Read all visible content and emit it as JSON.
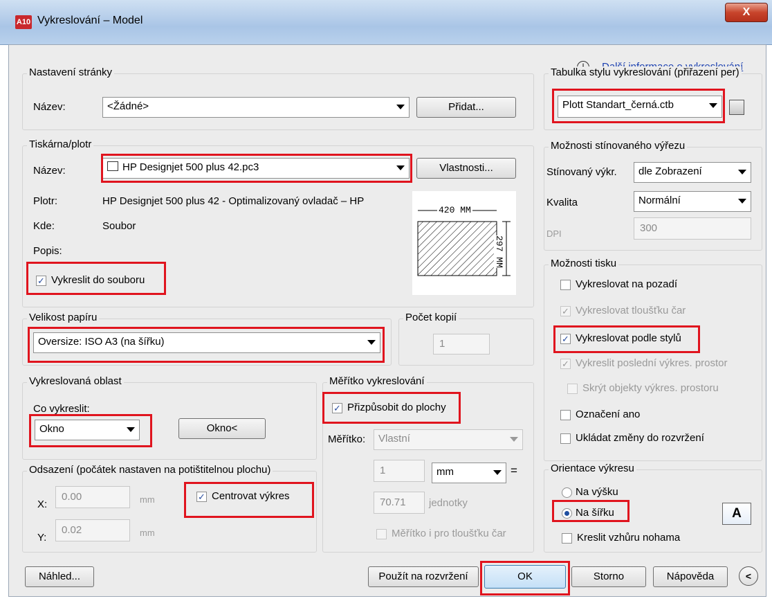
{
  "window": {
    "title": "Vykreslování – Model",
    "icon_text": "A10",
    "close_label": "X"
  },
  "more_info_link": "Další informace o vykreslování",
  "page_setup": {
    "group_label": "Nastavení stránky",
    "name_label": "Název:",
    "name_value": "<Žádné>",
    "add_button": "Přidat..."
  },
  "printer": {
    "group_label": "Tiskárna/plotr",
    "name_label": "Název:",
    "name_value": "HP Designjet 500 plus 42.pc3",
    "properties_button": "Vlastnosti...",
    "plotter_label": "Plotr:",
    "plotter_value": "HP Designjet 500 plus 42 - Optimalizovaný ovladač – HP",
    "where_label": "Kde:",
    "where_value": "Soubor",
    "desc_label": "Popis:",
    "plot_to_file_label": "Vykreslit do souboru",
    "plot_to_file_checked": true,
    "preview_width_label": "420 MM",
    "preview_height_label": "297 MM"
  },
  "paper_size": {
    "group_label": "Velikost papíru",
    "value": "Oversize: ISO A3 (na šířku)"
  },
  "copies": {
    "group_label": "Počet kopií",
    "value": "1"
  },
  "plot_area": {
    "group_label": "Vykreslovaná oblast",
    "what_label": "Co vykreslit:",
    "what_value": "Okno",
    "window_button": "Okno<"
  },
  "offset": {
    "group_label": "Odsazení (počátek nastaven na potištitelnou plochu)",
    "x_label": "X:",
    "x_value": "0.00",
    "y_label": "Y:",
    "y_value": "0.02",
    "unit": "mm",
    "center_label": "Centrovat výkres",
    "center_checked": true
  },
  "scale": {
    "group_label": "Měřítko vykreslování",
    "fit_label": "Přizpůsobit do plochy",
    "fit_checked": true,
    "scale_label": "Měřítko:",
    "scale_value": "Vlastní",
    "value1": "1",
    "unit_value": "mm",
    "equals": "=",
    "value2": "70.71",
    "units_label": "jednotky",
    "lineweights_label": "Měřítko i pro tloušťku čar"
  },
  "plot_style_table": {
    "group_label": "Tabulka stylu vykreslování (přiřazení per)",
    "value": "Plott Standart_černá.ctb"
  },
  "shaded_viewport": {
    "group_label": "Možnosti stínovaného výřezu",
    "shade_label": "Stínovaný výkr.",
    "shade_value": "dle Zobrazení",
    "quality_label": "Kvalita",
    "quality_value": "Normální",
    "dpi_label": "DPI",
    "dpi_value": "300"
  },
  "plot_options": {
    "group_label": "Možnosti tisku",
    "items": [
      {
        "label": "Vykreslovat na pozadí",
        "checked": false,
        "enabled": true
      },
      {
        "label": "Vykreslovat tloušťku čar",
        "checked": true,
        "enabled": false
      },
      {
        "label": "Vykreslovat podle stylů",
        "checked": true,
        "enabled": true
      },
      {
        "label": "Vykreslit poslední výkres. prostor",
        "checked": true,
        "enabled": false
      },
      {
        "label": "Skrýt objekty výkres. prostoru",
        "checked": false,
        "enabled": false
      },
      {
        "label": "Označení ano",
        "checked": false,
        "enabled": true
      },
      {
        "label": "Ukládat změny do rozvržení",
        "checked": false,
        "enabled": true
      }
    ]
  },
  "orientation": {
    "group_label": "Orientace výkresu",
    "portrait_label": "Na výšku",
    "landscape_label": "Na šířku",
    "selected": "landscape",
    "upside_down_label": "Kreslit vzhůru nohama",
    "upside_down_checked": false,
    "icon_letter": "A"
  },
  "buttons": {
    "preview": "Náhled...",
    "apply_layout": "Použít na rozvržení",
    "ok": "OK",
    "cancel": "Storno",
    "help": "Nápověda"
  }
}
